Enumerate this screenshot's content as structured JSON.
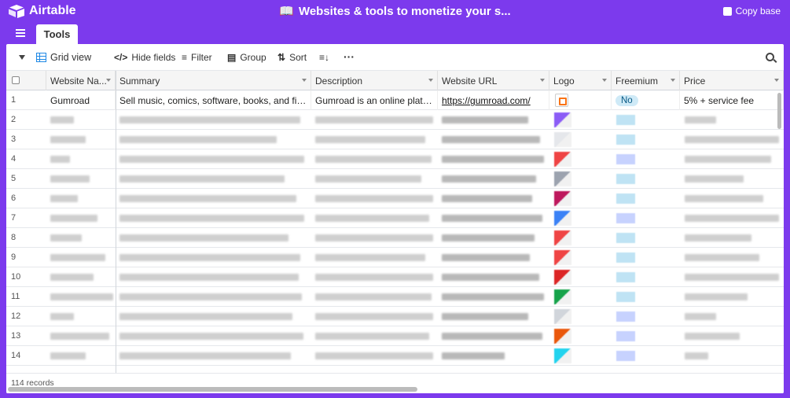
{
  "app": {
    "name": "Airtable",
    "base_title": "Websites & tools to monetize your s...",
    "copy_base": "Copy base"
  },
  "tabs": [
    {
      "label": "Tools"
    }
  ],
  "toolbar": {
    "view": "Grid view",
    "hide_fields": "Hide fields",
    "filter": "Filter",
    "group": "Group",
    "sort": "Sort",
    "more": "···"
  },
  "columns": [
    {
      "label": "Website Na..."
    },
    {
      "label": "Summary"
    },
    {
      "label": "Description"
    },
    {
      "label": "Website URL"
    },
    {
      "label": "Logo"
    },
    {
      "label": "Freemium"
    },
    {
      "label": "Price"
    }
  ],
  "rows": [
    {
      "num": "1",
      "name": "Gumroad",
      "summary": "Sell music, comics, software, books, and films direc...",
      "description": "Gumroad is an online platform ...",
      "url": "https://gumroad.com/",
      "freemium": "No",
      "price": "5% + service fee"
    },
    {
      "num": "2"
    },
    {
      "num": "3"
    },
    {
      "num": "4"
    },
    {
      "num": "5"
    },
    {
      "num": "6"
    },
    {
      "num": "7"
    },
    {
      "num": "8"
    },
    {
      "num": "9"
    },
    {
      "num": "10"
    },
    {
      "num": "11"
    },
    {
      "num": "12"
    },
    {
      "num": "13"
    },
    {
      "num": "14"
    }
  ],
  "footer": {
    "records": "114 records"
  },
  "colors": {
    "accent": "#7c3aed",
    "badge_bg": "#cfeaf7"
  }
}
